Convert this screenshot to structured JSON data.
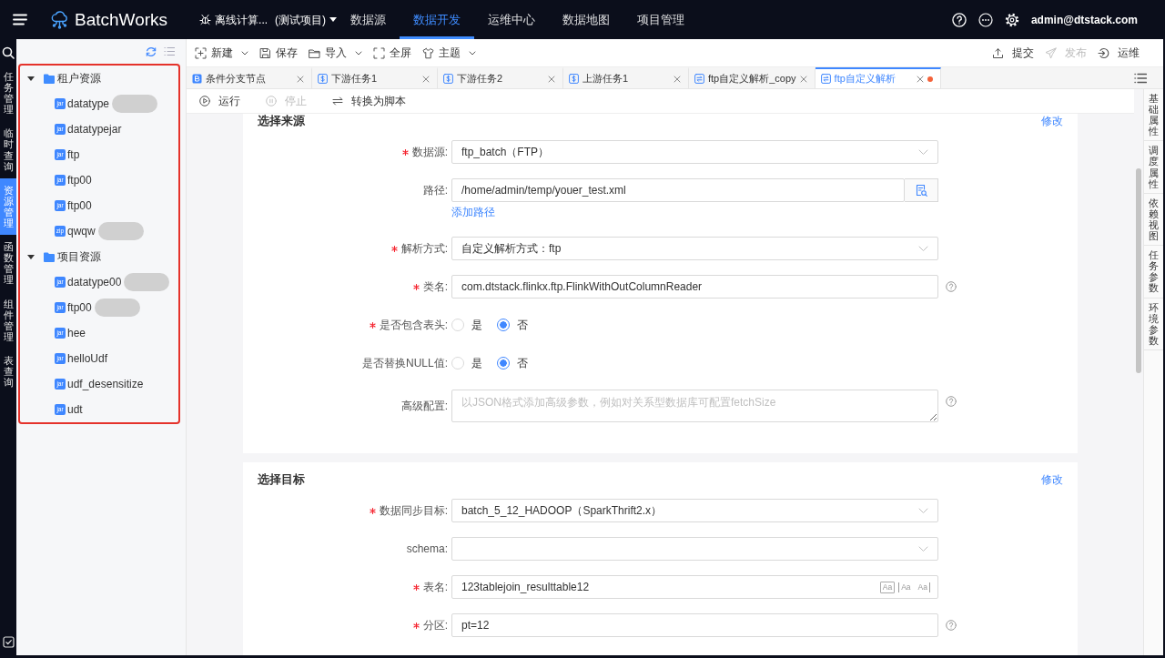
{
  "top_nav": {
    "app_name": "BatchWorks",
    "project": {
      "name": "离线计算...",
      "tag": "(测试项目)"
    },
    "menu": [
      {
        "label": "数据源",
        "selected": false
      },
      {
        "label": "数据开发",
        "selected": true
      },
      {
        "label": "运维中心",
        "selected": false
      },
      {
        "label": "数据地图",
        "selected": false
      },
      {
        "label": "项目管理",
        "selected": false
      }
    ],
    "user": "admin@dtstack.com"
  },
  "side_rail": [
    {
      "label": "任务管理",
      "selected": false
    },
    {
      "label": "临时查询",
      "selected": false
    },
    {
      "label": "资源管理",
      "selected": true
    },
    {
      "label": "函数管理",
      "selected": false
    },
    {
      "label": "组件管理",
      "selected": false
    },
    {
      "label": "表查询",
      "selected": false
    }
  ],
  "resource_tree": {
    "highlighted": true,
    "items": [
      {
        "label": "租户资源",
        "expanded": true,
        "children": [
          {
            "label": "datatype",
            "type": "jar",
            "redacted": true
          },
          {
            "label": "datatypejar",
            "type": "jar",
            "redacted": false
          },
          {
            "label": "ftp",
            "type": "jar",
            "redacted": false
          },
          {
            "label": "ftp00",
            "type": "jar",
            "redacted": false
          },
          {
            "label": "ftp00",
            "type": "jar",
            "redacted": false
          },
          {
            "label": "qwqw",
            "type": "zip",
            "redacted": true
          }
        ]
      },
      {
        "label": "项目资源",
        "expanded": true,
        "children": [
          {
            "label": "datatype00",
            "type": "jar",
            "redacted": true
          },
          {
            "label": "ftp00",
            "type": "jar",
            "redacted": true
          },
          {
            "label": "hee",
            "type": "jar",
            "redacted": false
          },
          {
            "label": "helloUdf",
            "type": "jar",
            "redacted": false
          },
          {
            "label": "udf_desensitize",
            "type": "jar",
            "redacted": false
          },
          {
            "label": "udt",
            "type": "jar",
            "redacted": false
          }
        ]
      }
    ]
  },
  "toolbar": {
    "left": [
      {
        "label": "新建",
        "dropdown": true
      },
      {
        "label": "保存",
        "dropdown": false
      },
      {
        "label": "导入",
        "dropdown": true
      },
      {
        "label": "全屏",
        "dropdown": false
      },
      {
        "label": "主题",
        "dropdown": true
      }
    ],
    "right": [
      {
        "label": "提交",
        "disabled": false
      },
      {
        "label": "发布",
        "disabled": true
      },
      {
        "label": "运维",
        "disabled": false
      }
    ]
  },
  "tabs": [
    {
      "label": "条件分支节点",
      "kind": "branch",
      "selected": false,
      "unsaved": false
    },
    {
      "label": "下游任务1",
      "kind": "script",
      "selected": false,
      "unsaved": false
    },
    {
      "label": "下游任务2",
      "kind": "script",
      "selected": false,
      "unsaved": false
    },
    {
      "label": "上游任务1",
      "kind": "script",
      "selected": false,
      "unsaved": false
    },
    {
      "label": "ftp自定义解析_copy",
      "kind": "sync",
      "selected": false,
      "unsaved": false
    },
    {
      "label": "ftp自定义解析",
      "kind": "sync",
      "selected": true,
      "unsaved": true
    }
  ],
  "actions": [
    {
      "label": "运行",
      "disabled": false
    },
    {
      "label": "停止",
      "disabled": true
    },
    {
      "label": "转换为脚本",
      "disabled": false
    }
  ],
  "side_panel_tabs": [
    "基础属性",
    "调度属性",
    "依赖视图",
    "任务参数",
    "环境参数"
  ],
  "sections": [
    {
      "title": "选择来源",
      "action": "修改",
      "fields": [
        {
          "kind": "select",
          "label": "数据源:",
          "required": true,
          "value": "ftp_batch（FTP）"
        },
        {
          "kind": "input",
          "label": "路径:",
          "required": false,
          "value": "/home/admin/temp/youer_test.xml",
          "addon": true,
          "link": "添加路径"
        },
        {
          "kind": "select",
          "label": "解析方式:",
          "required": true,
          "value": "自定义解析方式：ftp"
        },
        {
          "kind": "input",
          "label": "类名:",
          "required": true,
          "value": "com.dtstack.flinkx.ftp.FlinkWithOutColumnReader",
          "help": true
        },
        {
          "kind": "radio",
          "label": "是否包含表头:",
          "required": true,
          "options": [
            {
              "label": "是",
              "selected": false
            },
            {
              "label": "否",
              "selected": true
            }
          ]
        },
        {
          "kind": "radio",
          "label": "是否替换NULL值:",
          "required": false,
          "options": [
            {
              "label": "是",
              "selected": false
            },
            {
              "label": "否",
              "selected": true
            }
          ]
        },
        {
          "kind": "textarea",
          "label": "高级配置:",
          "required": false,
          "placeholder": "以JSON格式添加高级参数，例如对关系型数据库可配置fetchSize",
          "help": true
        }
      ]
    },
    {
      "title": "选择目标",
      "action": "修改",
      "fields": [
        {
          "kind": "select",
          "label": "数据同步目标:",
          "required": true,
          "value": "batch_5_12_HADOOP（SparkThrift2.x）"
        },
        {
          "kind": "select",
          "label": "schema:",
          "required": false
        },
        {
          "kind": "input",
          "label": "表名:",
          "required": true,
          "value": "123tablejoin_resulttable12",
          "suffix_buttons": [
            "Aa",
            "Aa",
            "Aa"
          ]
        },
        {
          "kind": "input",
          "label": "分区:",
          "required": true,
          "value": "pt=12",
          "help": true
        }
      ]
    }
  ]
}
